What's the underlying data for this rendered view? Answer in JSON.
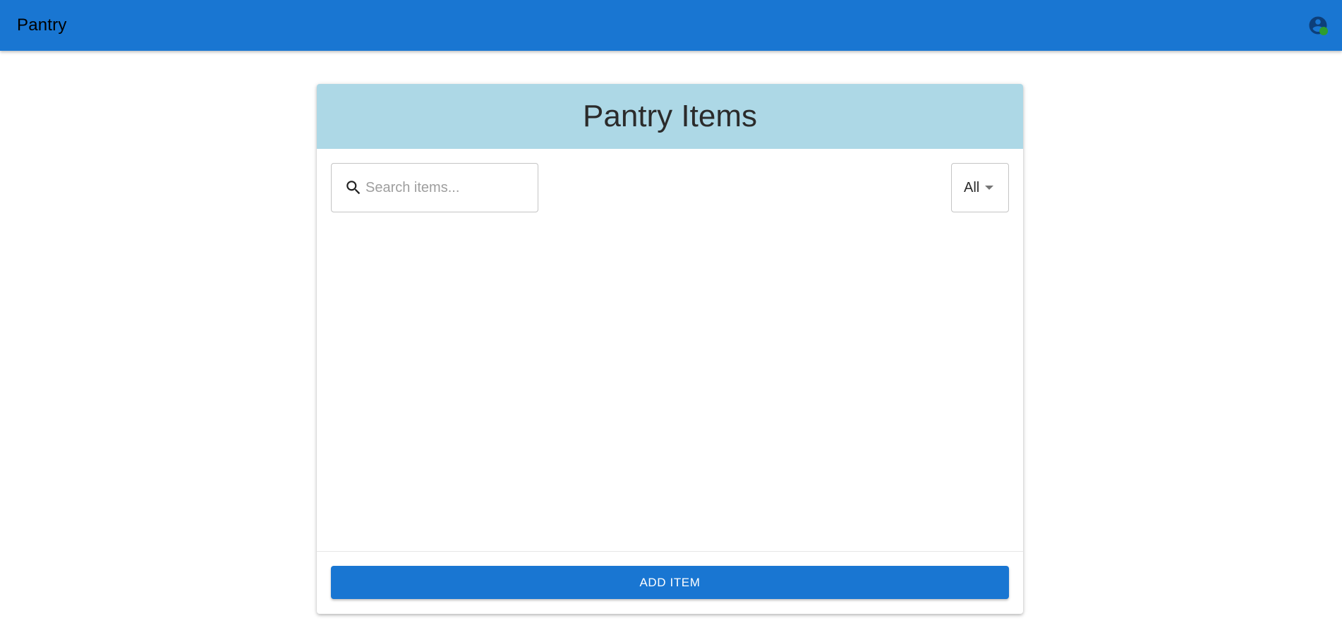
{
  "app_bar": {
    "title": "Pantry",
    "account_icon": "account-circle-icon",
    "status_color": "#2e9d2e"
  },
  "pantry": {
    "title": "Pantry Items",
    "search": {
      "icon": "search-icon",
      "placeholder": "Search items...",
      "value": ""
    },
    "filter": {
      "selected": "All",
      "icon": "caret-down-icon"
    },
    "items": [],
    "add_button_label": "ADD ITEM"
  },
  "colors": {
    "primary": "#1976d2",
    "header_bg": "#add8e6"
  }
}
